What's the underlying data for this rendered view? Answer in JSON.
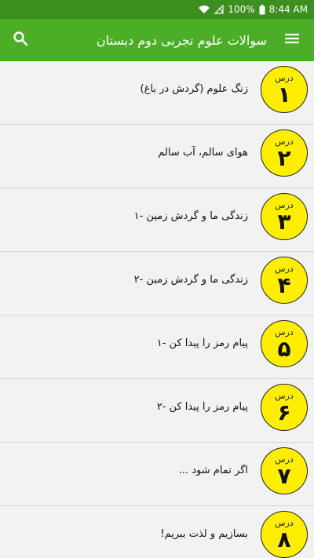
{
  "status": {
    "battery": "100%",
    "time": "8:44 AM"
  },
  "header": {
    "title": "سوالات علوم تجربی دوم دبستان"
  },
  "lesson_label": "درس",
  "lessons": [
    {
      "num": "۱",
      "title": "زنگ علوم (گردش در باغ)"
    },
    {
      "num": "۲",
      "title": "هوای سالم، آب سالم"
    },
    {
      "num": "۳",
      "title": "زندگی ما و گردش زمین -۱"
    },
    {
      "num": "۴",
      "title": "زندگی ما و گردش زمین -۲"
    },
    {
      "num": "۵",
      "title": "پیام رمز را پیدا کن -۱"
    },
    {
      "num": "۶",
      "title": "پیام رمز را پیدا کن -۲"
    },
    {
      "num": "۷",
      "title": "اگر تمام شود ..."
    },
    {
      "num": "۸",
      "title": "بسازیم و لذت ببریم!"
    }
  ]
}
